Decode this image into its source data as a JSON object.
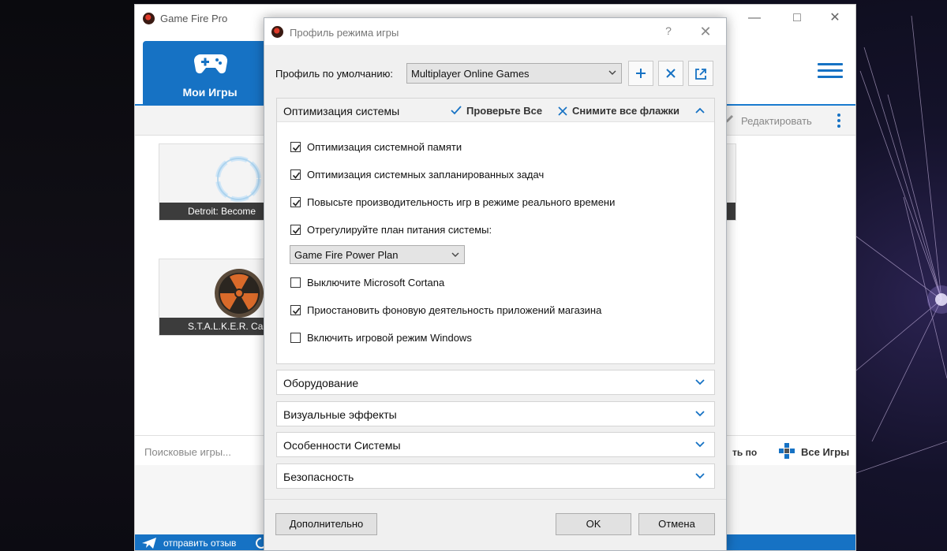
{
  "app": {
    "title": "Game Fire Pro",
    "tab_label": "Мои Игры",
    "edit_label": "Редактировать",
    "search_placeholder": "Поисковые игры...",
    "sort_label_partial": "ть по",
    "all_games_label": "Все Игры",
    "feedback_label": "отправить отзыв",
    "games": [
      {
        "label": "Detroit: Become"
      },
      {
        "label": "S.T.A.L.K.E.R. Call o"
      }
    ],
    "accent_color": "#1672c4"
  },
  "dialog": {
    "title": "Профиль режима игры",
    "help": "?",
    "profile_label": "Профиль по умолчанию:",
    "profile_value": "Multiplayer Online Games",
    "optimization": {
      "title": "Оптимизация системы",
      "check_all": "Проверьте Все",
      "uncheck_all": "Снимите все флажки",
      "options": [
        {
          "label": "Оптимизация системной памяти",
          "checked": true
        },
        {
          "label": "Оптимизация системных запланированных задач",
          "checked": true
        },
        {
          "label": "Повысьте производительность игр в режиме реального времени",
          "checked": true
        },
        {
          "label": "Отрегулируйте план питания системы:",
          "checked": true
        },
        {
          "label": "Выключите Microsoft Cortana",
          "checked": false
        },
        {
          "label": "Приостановить фоновую деятельность приложений магазина",
          "checked": true
        },
        {
          "label": "Включить игровой режим Windows",
          "checked": false
        }
      ],
      "power_plan_value": "Game Fire Power Plan"
    },
    "sections": [
      {
        "label": "Оборудование"
      },
      {
        "label": "Визуальные эффекты"
      },
      {
        "label": "Особенности Системы"
      },
      {
        "label": "Безопасность"
      }
    ],
    "buttons": {
      "advanced": "Дополнительно",
      "ok": "OK",
      "cancel": "Отмена"
    }
  }
}
